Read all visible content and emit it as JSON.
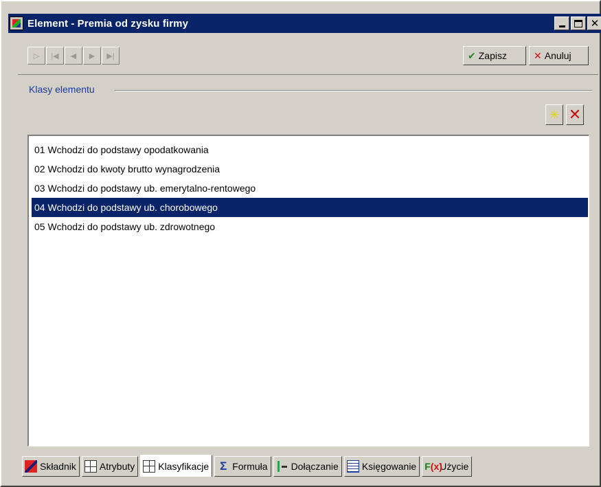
{
  "window": {
    "title": "Element - Premia od zysku firmy"
  },
  "toolbar": {
    "nav_icons": [
      "new-record-icon",
      "first-record-icon",
      "prev-record-icon",
      "next-record-icon",
      "last-record-icon"
    ],
    "save_label": "Zapisz",
    "cancel_label": "Anuluj"
  },
  "groupbox": {
    "label": "Klasy elementu"
  },
  "list": {
    "items": [
      "01 Wchodzi do podstawy opodatkowania",
      "02 Wchodzi do kwoty brutto wynagrodzenia",
      "03 Wchodzi do podstawy ub. emerytalno-rentowego",
      "04 Wchodzi do podstawy ub. chorobowego",
      "05 Wchodzi do podstawy ub. zdrowotnego"
    ],
    "selected_index": 3
  },
  "tabs": [
    {
      "label": "Składnik",
      "icon": "skladnik-icon"
    },
    {
      "label": "Atrybuty",
      "icon": "atrybuty-icon"
    },
    {
      "label": "Klasyfikacje",
      "icon": "klasyfikacje-icon"
    },
    {
      "label": "Formuła",
      "icon": "sigma-icon"
    },
    {
      "label": "Dołączanie",
      "icon": "link-icon"
    },
    {
      "label": "Księgowanie",
      "icon": "ledger-icon"
    },
    {
      "label": "Użycie",
      "icon": "fx-icon"
    }
  ],
  "active_tab": 2,
  "colors": {
    "titlebar": "#0a246a",
    "selection": "#0a246a",
    "face": "#d4d0c8"
  }
}
